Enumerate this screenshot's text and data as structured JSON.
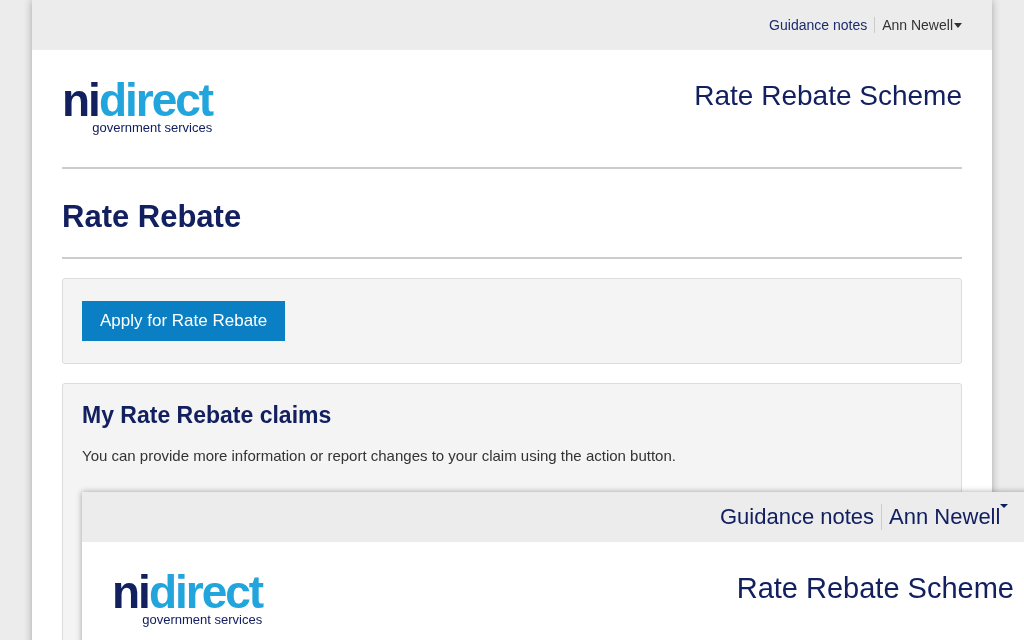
{
  "window": {
    "top_bar": {
      "guidance_link": "Guidance notes",
      "user_menu": "Ann Newell"
    },
    "logo": {
      "part_1": "ni",
      "part_2": "direct",
      "tagline": "government services"
    },
    "service_name": "Rate Rebate Scheme",
    "page_title": "Rate Rebate",
    "apply_button": "Apply for Rate Rebate",
    "claims": {
      "heading": "My Rate Rebate claims",
      "intro": "You can provide more information or report changes to your claim using the action button."
    }
  },
  "overlay_window": {
    "top_bar": {
      "guidance_link": "Guidance notes",
      "user_menu": "Ann Newell"
    },
    "logo": {
      "part_1": "ni",
      "part_2": "direct",
      "tagline": "government services"
    },
    "service_name": "Rate Rebate Scheme"
  }
}
